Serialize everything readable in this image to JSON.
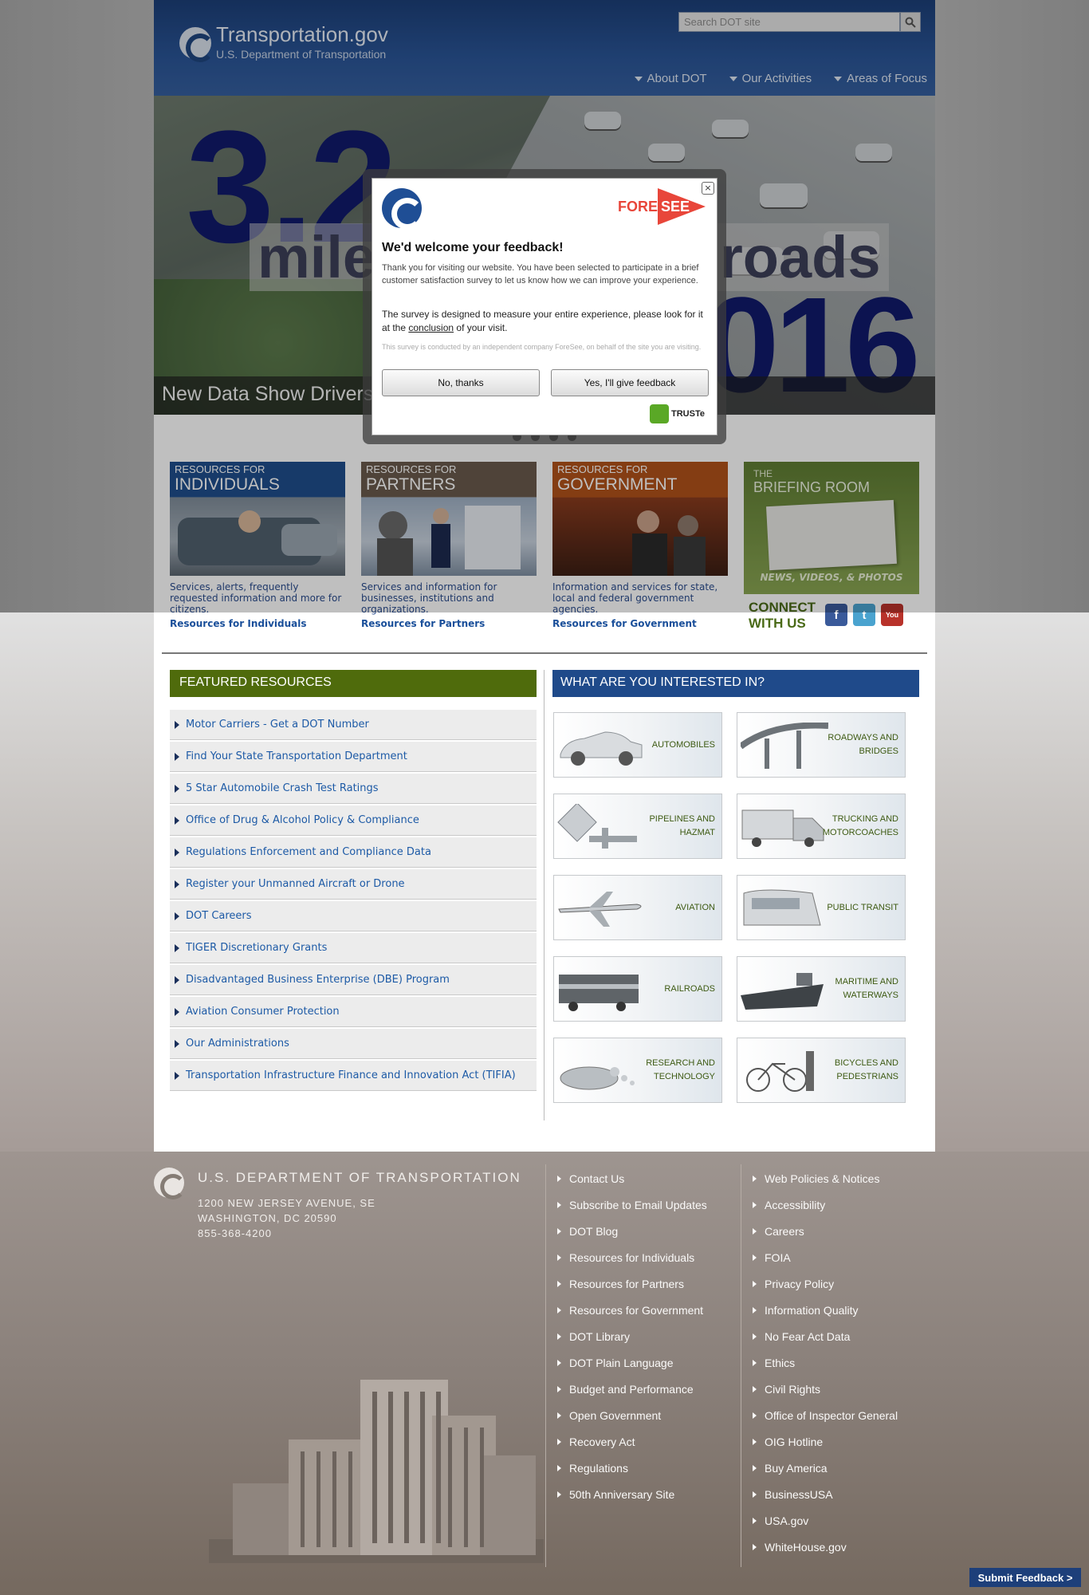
{
  "header": {
    "site_title": "Transportation.gov",
    "site_subtitle": "U.S. Department of Transportation",
    "search_placeholder": "Search DOT site",
    "nav": [
      "About DOT",
      "Our Activities",
      "Areas of Focus"
    ]
  },
  "hero": {
    "big_number": "3.2",
    "word_left": "miles",
    "word_right": "roads",
    "year": "016",
    "caption": "New Data Show Drivers"
  },
  "cards": [
    {
      "small": "RESOURCES FOR",
      "big": "INDIVIDUALS",
      "desc": "Services, alerts, frequently requested information and more for citizens.",
      "link": "Resources for Individuals",
      "color": "#1f4e8c"
    },
    {
      "small": "RESOURCES FOR",
      "big": "PARTNERS",
      "desc": "Services and information for businesses, institutions and organizations.",
      "link": "Resources for Partners",
      "color": "#6a5a4d"
    },
    {
      "small": "RESOURCES FOR",
      "big": "GOVERNMENT",
      "desc": "Information and services for state, local and federal government agencies.",
      "link": "Resources for Government",
      "color": "#b0521a"
    }
  ],
  "briefing": {
    "small": "THE",
    "big": "BRIEFING ROOM",
    "tagline": "NEWS, VIDEOS, & PHOTOS"
  },
  "connect": {
    "line1": "CONNECT",
    "line2": "WITH US"
  },
  "featured": {
    "heading": "FEATURED RESOURCES",
    "items": [
      "Motor Carriers - Get a DOT Number",
      "Find Your State Transportation Department",
      "5 Star Automobile Crash Test Ratings",
      "Office of Drug & Alcohol Policy & Compliance",
      "Regulations Enforcement and Compliance Data",
      "Register your Unmanned Aircraft or Drone",
      "DOT Careers",
      "TIGER Discretionary Grants",
      "Disadvantaged Business Enterprise (DBE) Program",
      "Aviation Consumer Protection",
      "Our Administrations",
      "Transportation Infrastructure Finance and Innovation Act (TIFIA)"
    ]
  },
  "interests": {
    "heading": "WHAT ARE YOU INTERESTED IN?",
    "tiles": [
      {
        "l1": "AUTOMOBILES",
        "l2": ""
      },
      {
        "l1": "ROADWAYS AND",
        "l2": "BRIDGES"
      },
      {
        "l1": "PIPELINES AND",
        "l2": "HAZMAT"
      },
      {
        "l1": "TRUCKING AND",
        "l2": "MOTORCOACHES"
      },
      {
        "l1": "AVIATION",
        "l2": ""
      },
      {
        "l1": "PUBLIC TRANSIT",
        "l2": ""
      },
      {
        "l1": "RAILROADS",
        "l2": ""
      },
      {
        "l1": "MARITIME AND",
        "l2": "WATERWAYS"
      },
      {
        "l1": "RESEARCH AND",
        "l2": "TECHNOLOGY"
      },
      {
        "l1": "BICYCLES AND",
        "l2": "PEDESTRIANS"
      }
    ]
  },
  "footer": {
    "title": "U.S. DEPARTMENT OF TRANSPORTATION",
    "address1": "1200 NEW JERSEY AVENUE, SE",
    "address2": "WASHINGTON, DC 20590",
    "phone": "855-368-4200",
    "col1": [
      "Contact Us",
      "Subscribe to Email Updates",
      "DOT Blog",
      "Resources for Individuals",
      "Resources for Partners",
      "Resources for Government",
      "DOT Library",
      "DOT Plain Language",
      "Budget and Performance",
      "Open Government",
      "Recovery Act",
      "Regulations",
      "50th Anniversary Site"
    ],
    "col2": [
      "Web Policies & Notices",
      "Accessibility",
      "Careers",
      "FOIA",
      "Privacy Policy",
      "Information Quality",
      "No Fear Act Data",
      "Ethics",
      "Civil Rights",
      "Office of Inspector General",
      "OIG Hotline",
      "Buy America",
      "BusinessUSA",
      "USA.gov",
      "WhiteHouse.gov"
    ]
  },
  "submit_feedback": "Submit Feedback >",
  "modal": {
    "brand_fore": "FORE",
    "brand_see": "SEE",
    "title": "We'd welcome your feedback!",
    "p1": "Thank you for visiting our website. You have been selected to participate in a brief customer satisfaction survey to let us know how we can improve your experience.",
    "p2_before": "The survey is designed to measure your entire experience, please look for it at the ",
    "p2_link": "conclusion",
    "p2_after": " of your visit.",
    "p3": "This survey is conducted by an independent company ForeSee, on behalf of the site you are visiting.",
    "btn_no": "No, thanks",
    "btn_yes": "Yes, I'll give feedback",
    "truste": "TRUSTe",
    "close": "×"
  }
}
